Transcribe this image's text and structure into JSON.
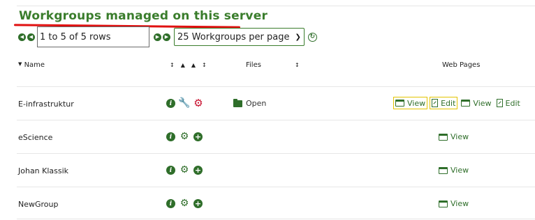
{
  "title": "Workgroups managed on this server",
  "pager": {
    "rows_text": "1 to 5 of 5 rows",
    "per_page": "25 Workgroups per page"
  },
  "columns": {
    "name": "Name",
    "files": "Files",
    "web_pages": "Web Pages"
  },
  "rows": [
    {
      "name": "E-infrastruktur",
      "files_label": "Open",
      "wp": [
        "View",
        "Edit",
        "View",
        "Edit"
      ]
    },
    {
      "name": "eScience",
      "wp": [
        "View"
      ]
    },
    {
      "name": "Johan Klassik",
      "wp": [
        "View"
      ]
    },
    {
      "name": "NewGroup",
      "wp": [
        "View"
      ]
    }
  ],
  "colors": {
    "accent": "#2f6e2a",
    "title": "#3a7d2c",
    "underline": "#e01010",
    "highlight": "#e3c400",
    "danger": "#c8102e"
  }
}
